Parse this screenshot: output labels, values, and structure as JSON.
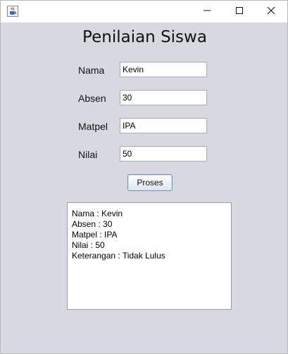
{
  "window": {
    "icon": "java-cup-icon",
    "controls": [
      "minimize-icon",
      "maximize-icon",
      "close-icon"
    ]
  },
  "form": {
    "title": "Penilaian Siswa",
    "fields": [
      {
        "label": "Nama",
        "value": "Kevin"
      },
      {
        "label": "Absen",
        "value": "30"
      },
      {
        "label": "Matpel",
        "value": "IPA"
      },
      {
        "label": "Nilai",
        "value": "50"
      }
    ],
    "button_label": "Proses"
  },
  "output": {
    "lines": [
      "Nama : Kevin",
      "Absen : 30",
      "Matpel : IPA",
      "Nilai : 50",
      "Keterangan : Tidak Lulus"
    ]
  }
}
